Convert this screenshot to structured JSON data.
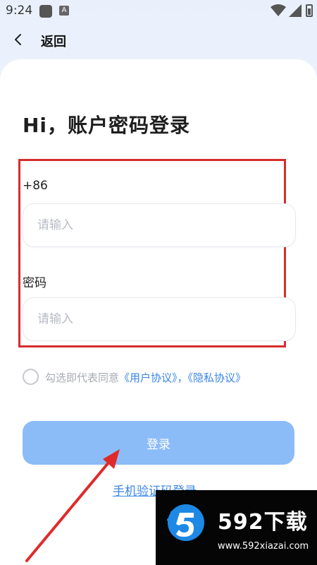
{
  "status_bar": {
    "time": "9:24",
    "notification_badge": "A",
    "icons": [
      "app-square-icon",
      "wifi-icon",
      "signal-icon",
      "battery-icon"
    ]
  },
  "nav": {
    "back_icon": "chevron-left-icon",
    "back_label": "返回"
  },
  "page": {
    "title": "Hi，账户密码登录"
  },
  "form": {
    "phone_label": "+86",
    "phone_placeholder": "请输入",
    "phone_value": "",
    "password_label": "密码",
    "password_placeholder": "请输入",
    "password_value": ""
  },
  "agreement": {
    "checked": false,
    "prefix": "勾选即代表同意",
    "user_agreement": "《用户协议》",
    "separator": "，",
    "privacy_agreement": "《隐私协议》"
  },
  "actions": {
    "login_label": "登录",
    "sms_login_label": "手机验证码登录"
  },
  "watermark": {
    "title": "592下载",
    "url": "www.592xiazai.com"
  },
  "colors": {
    "accent": "#3a86e6",
    "button": "#8bbcf7",
    "highlight": "#d62d2d",
    "header_bg": "#e9f0fc"
  }
}
